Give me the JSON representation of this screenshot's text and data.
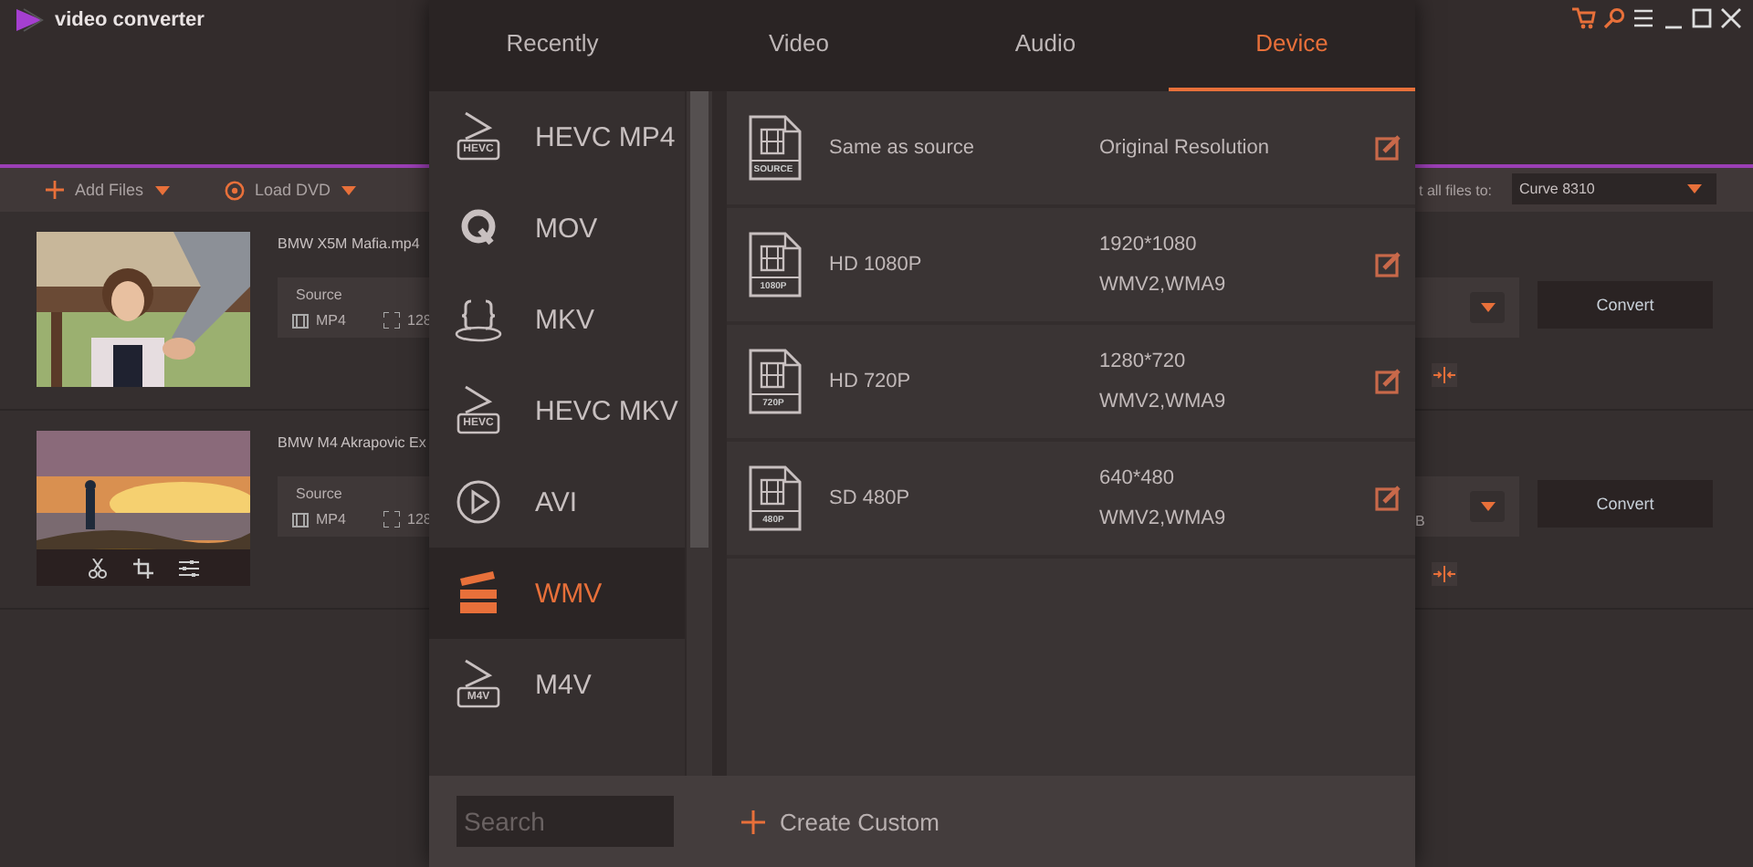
{
  "window": {
    "title": "video converter"
  },
  "toolbar": {
    "add_files": "Add Files",
    "load_dvd": "Load DVD",
    "convert_all_label": "t all files to:",
    "convert_all_target": "Curve 8310"
  },
  "files": [
    {
      "name": "BMW X5M Mafia.mp4",
      "source_label": "Source",
      "format": "MP4",
      "resolution": "128",
      "convert": "Convert",
      "show_tools": false
    },
    {
      "name": "BMW M4 Akrapovic Ex",
      "source_label": "Source",
      "format": "MP4",
      "resolution": "128",
      "extra": "B",
      "convert": "Convert",
      "show_tools": true
    }
  ],
  "popup": {
    "tabs": [
      {
        "label": "Recently",
        "selected": false
      },
      {
        "label": "Video",
        "selected": false
      },
      {
        "label": "Audio",
        "selected": false
      },
      {
        "label": "Device",
        "selected": true
      }
    ],
    "formats": [
      {
        "label": "HEVC MP4",
        "kind": "hevc",
        "icon_text": "HEVC",
        "selected": false
      },
      {
        "label": "MOV",
        "kind": "quicktime",
        "selected": false
      },
      {
        "label": "MKV",
        "kind": "braces",
        "selected": false
      },
      {
        "label": "HEVC MKV",
        "kind": "hevc",
        "icon_text": "HEVC",
        "selected": false
      },
      {
        "label": "AVI",
        "kind": "play",
        "selected": false
      },
      {
        "label": "WMV",
        "kind": "clapper",
        "selected": true
      },
      {
        "label": "M4V",
        "kind": "hevc",
        "icon_text": "M4V",
        "selected": false
      }
    ],
    "presets": [
      {
        "name": "Same as source",
        "icon_text": "SOURCE",
        "details": [
          "Original Resolution"
        ]
      },
      {
        "name": "HD 1080P",
        "icon_text": "1080P",
        "details": [
          "1920*1080",
          "WMV2,WMA9"
        ]
      },
      {
        "name": "HD 720P",
        "icon_text": "720P",
        "details": [
          "1280*720",
          "WMV2,WMA9"
        ]
      },
      {
        "name": "SD 480P",
        "icon_text": "480P",
        "details": [
          "640*480",
          "WMV2,WMA9"
        ]
      }
    ],
    "search": {
      "placeholder": "Search"
    },
    "create_custom": "Create Custom"
  }
}
